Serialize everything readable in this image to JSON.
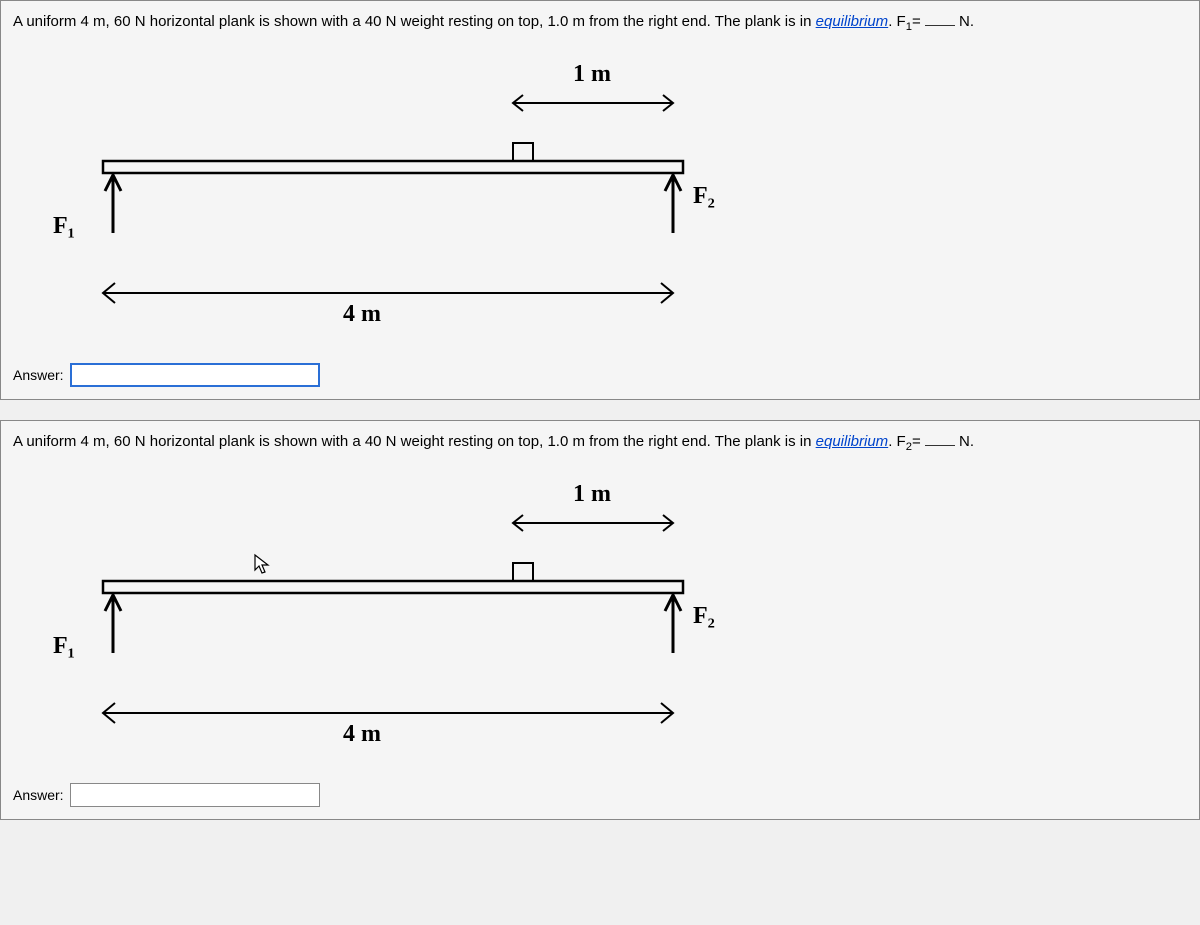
{
  "questions": [
    {
      "prefix": "A uniform 4 m, 60 N horizontal plank is shown with a 40 N weight resting on top, 1.0 m from the right end. The plank is in ",
      "equilibrium": "equilibrium",
      "suffix_before_var": ".  F",
      "var_sub": "1",
      "suffix_after_var": "= ",
      "unit_suffix": " N.",
      "answer_label": "Answer:",
      "diagram": {
        "length_label": "4 m",
        "weight_dist_label": "1 m",
        "f1_label": "F₁",
        "f2_label": "F₂"
      },
      "input_active": true
    },
    {
      "prefix": "A uniform 4 m, 60 N horizontal plank is shown with a 40 N weight resting on top, 1.0 m from the right end. The plank is in ",
      "equilibrium": "equilibrium",
      "suffix_before_var": ".  F",
      "var_sub": "2",
      "suffix_after_var": "= ",
      "unit_suffix": " N.",
      "answer_label": "Answer:",
      "diagram": {
        "length_label": "4 m",
        "weight_dist_label": "1 m",
        "f1_label": "F₁",
        "f2_label": "F₂"
      },
      "input_active": false
    }
  ]
}
